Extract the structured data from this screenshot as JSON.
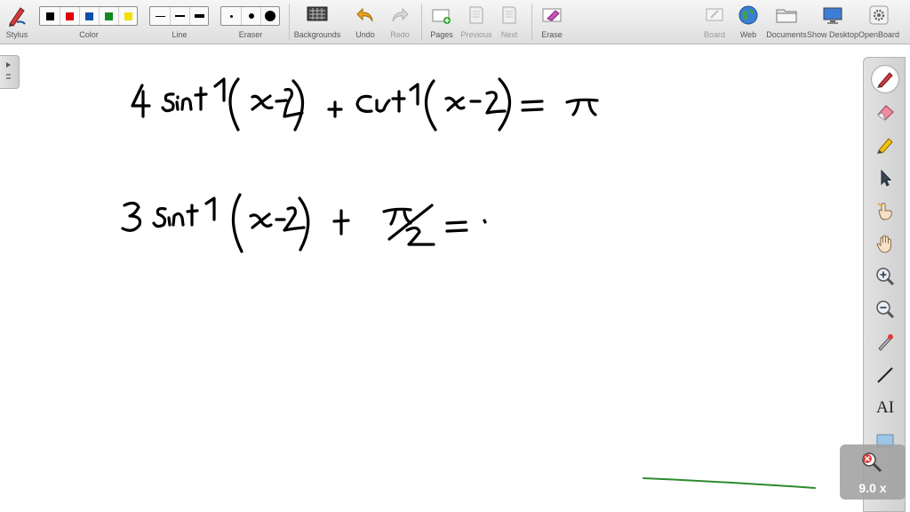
{
  "toolbar": {
    "stylus_label": "Stylus",
    "color_label": "Color",
    "line_label": "Line",
    "eraser_label": "Eraser",
    "backgrounds_label": "Backgrounds",
    "undo_label": "Undo",
    "redo_label": "Redo",
    "pages_label": "Pages",
    "previous_label": "Previous",
    "next_label": "Next",
    "erase_label": "Erase",
    "board_label": "Board",
    "web_label": "Web",
    "documents_label": "Documents",
    "show_desktop_label": "Show Desktop",
    "openboard_label": "OpenBoard"
  },
  "colors": {
    "swatches": [
      "#000000",
      "#e00000",
      "#0a4fa6",
      "#0f8a1e",
      "#f0e000"
    ],
    "ink": "#000000",
    "stroke_green": "#2e8b2e"
  },
  "side_tools": [
    "pen-icon",
    "eraser-icon",
    "highlighter-icon",
    "pointer-icon",
    "hand-pointer-icon",
    "pan-hand-icon",
    "zoom-in-icon",
    "zoom-out-icon",
    "laser-icon",
    "line-icon",
    "text-icon",
    "capture-icon"
  ],
  "side_text_tool_label": "AI",
  "zoom": {
    "value": "9.0 x"
  }
}
